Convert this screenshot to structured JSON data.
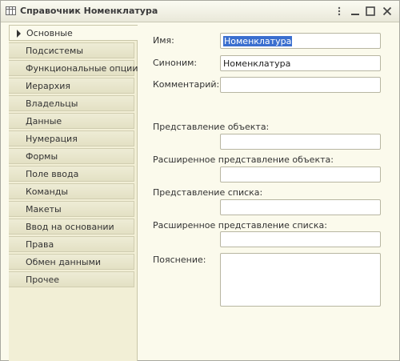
{
  "window": {
    "title": "Справочник Номенклатура",
    "icons": {
      "app": "table-icon",
      "menu": "menu-dots-icon",
      "minimize": "minimize-icon",
      "maximize": "maximize-icon",
      "close": "close-icon"
    }
  },
  "sidebar": {
    "items": [
      {
        "label": "Основные",
        "active": true
      },
      {
        "label": "Подсистемы"
      },
      {
        "label": "Функциональные опции"
      },
      {
        "label": "Иерархия"
      },
      {
        "label": "Владельцы"
      },
      {
        "label": "Данные"
      },
      {
        "label": "Нумерация"
      },
      {
        "label": "Формы"
      },
      {
        "label": "Поле ввода"
      },
      {
        "label": "Команды"
      },
      {
        "label": "Макеты"
      },
      {
        "label": "Ввод на основании"
      },
      {
        "label": "Права"
      },
      {
        "label": "Обмен данными"
      },
      {
        "label": "Прочее"
      }
    ]
  },
  "form": {
    "name_label": "Имя:",
    "name_value": "Номенклатура",
    "synonym_label": "Синоним:",
    "synonym_value": "Номенклатура",
    "comment_label": "Комментарий:",
    "comment_value": "",
    "object_presentation_label": "Представление объекта:",
    "object_presentation_value": "",
    "ext_object_presentation_label": "Расширенное представление объекта:",
    "ext_object_presentation_value": "",
    "list_presentation_label": "Представление списка:",
    "list_presentation_value": "",
    "ext_list_presentation_label": "Расширенное представление списка:",
    "ext_list_presentation_value": "",
    "explanation_label": "Пояснение:",
    "explanation_value": ""
  },
  "colors": {
    "selection": "#3b6fcf",
    "window_bg": "#fbfaec",
    "sidebar_bg": "#f2efd6"
  }
}
